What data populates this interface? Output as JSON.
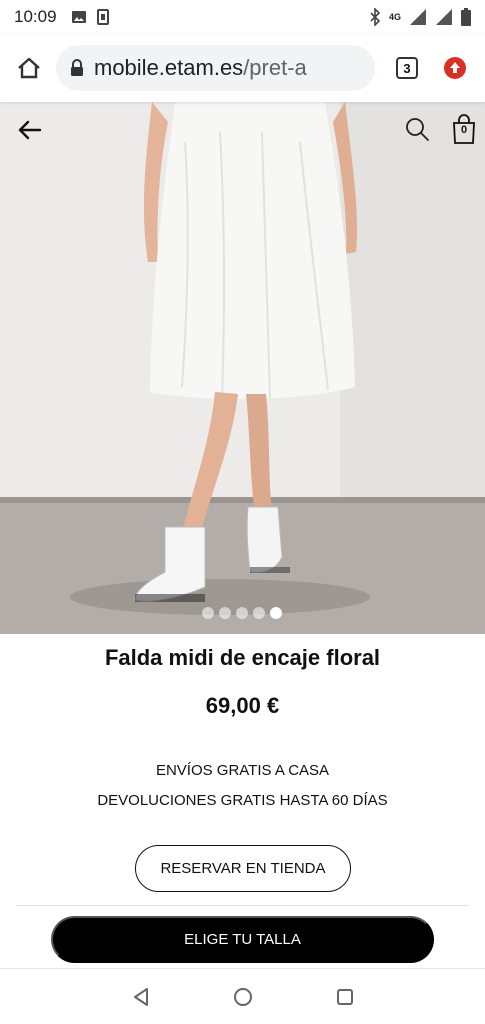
{
  "status_bar": {
    "time": "10:09",
    "network": "4G"
  },
  "browser": {
    "url_host": "mobile.etam.es",
    "url_path": "/pret-a",
    "tab_count": "3"
  },
  "product": {
    "cart_count": "0",
    "image_count": 5,
    "active_image": 5,
    "title": "Falda midi de encaje floral",
    "price": "69,00 €",
    "shipping_text": "ENVÍOS GRATIS A CASA",
    "returns_text": "DEVOLUCIONES GRATIS HASTA 60 DÍAS",
    "reserve_label": "RESERVAR EN TIENDA",
    "size_label": "ELIGE TU TALLA"
  },
  "icons": {
    "home": "home-icon",
    "lock": "lock-icon",
    "menu": "update-menu-icon",
    "back": "arrow-left-icon",
    "search": "search-icon",
    "bag": "shopping-bag-icon",
    "wishlist": "heart-icon"
  },
  "colors": {
    "accent": "#000000",
    "menu_badge": "#d93025"
  }
}
